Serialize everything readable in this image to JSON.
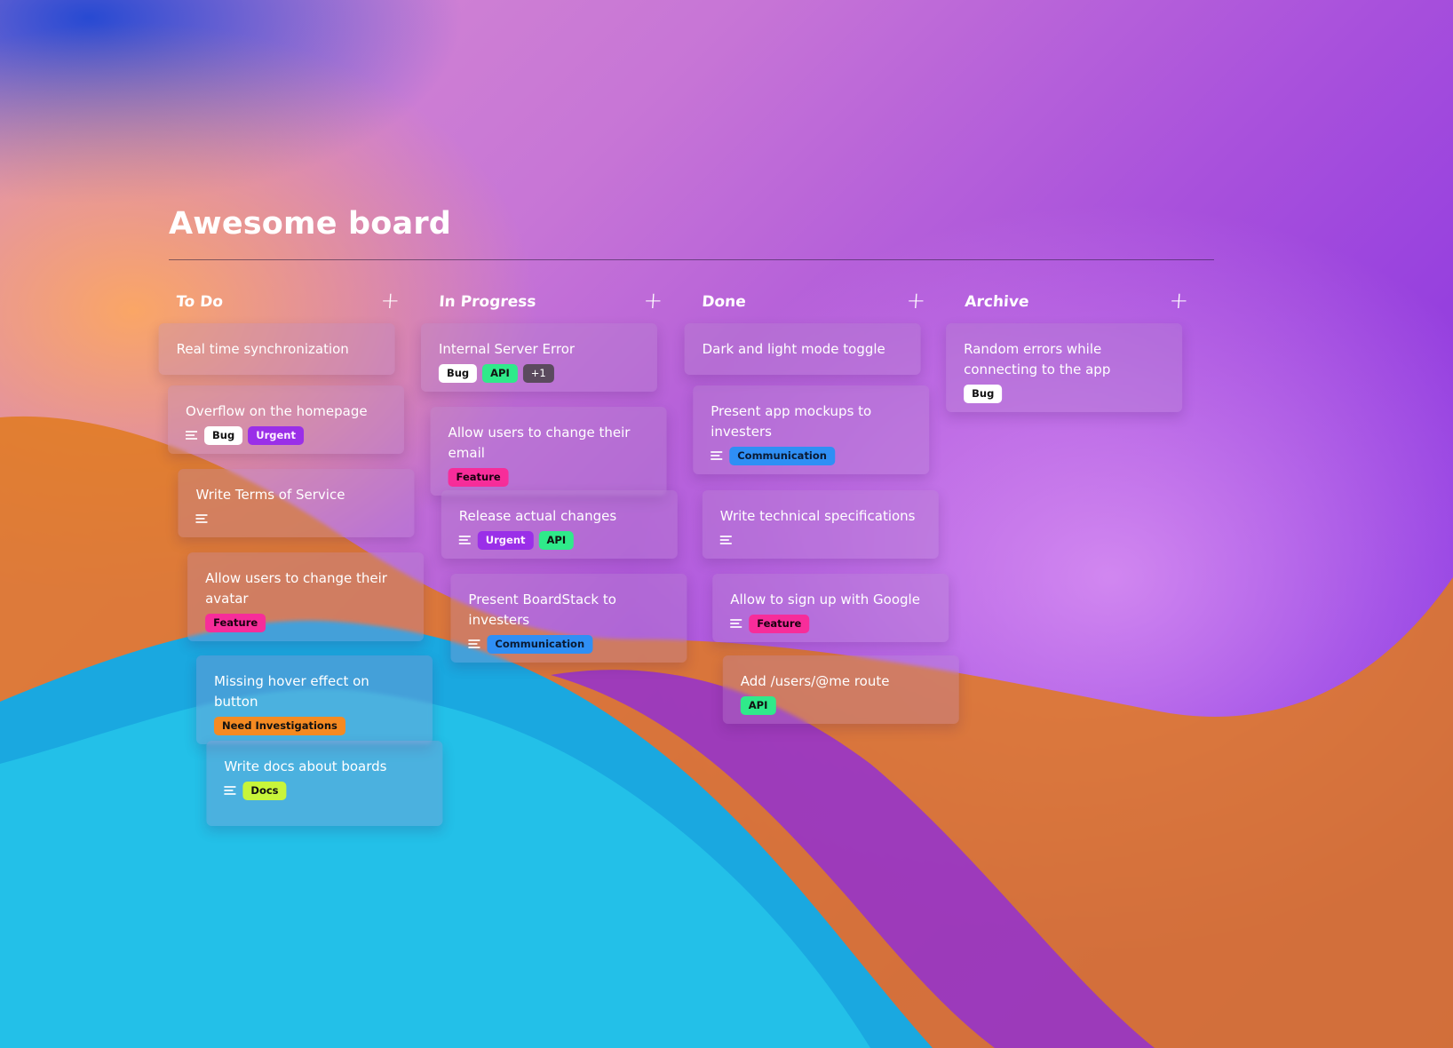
{
  "board": {
    "title": "Awesome board"
  },
  "columns": [
    {
      "title": "To Do",
      "add_label": "+",
      "cards": [
        {
          "title": "Real time synchronization",
          "has_description": false,
          "tags": []
        },
        {
          "title": "Overflow on the homepage",
          "has_description": true,
          "tags": [
            "Bug",
            "Urgent"
          ]
        },
        {
          "title": "Write Terms of Service",
          "has_description": true,
          "tags": []
        },
        {
          "title": "Allow users to change their avatar",
          "has_description": false,
          "tags": [
            "Feature"
          ]
        },
        {
          "title": "Missing hover effect on button",
          "has_description": false,
          "tags": [
            "Need Investigations"
          ]
        },
        {
          "title": "Write docs about boards",
          "has_description": true,
          "tags": [
            "Docs"
          ]
        }
      ]
    },
    {
      "title": "In Progress",
      "add_label": "+",
      "cards": [
        {
          "title": "Internal Server Error",
          "has_description": false,
          "tags": [
            "Bug",
            "API"
          ],
          "more": "+1"
        },
        {
          "title": "Allow users to change their email",
          "has_description": false,
          "tags": [
            "Feature"
          ]
        },
        {
          "title": "Release actual changes",
          "has_description": true,
          "tags": [
            "Urgent",
            "API"
          ]
        },
        {
          "title": "Present BoardStack to investers",
          "has_description": true,
          "tags": [
            "Communication"
          ]
        }
      ]
    },
    {
      "title": "Done",
      "add_label": "+",
      "cards": [
        {
          "title": "Dark and light mode toggle",
          "has_description": false,
          "tags": []
        },
        {
          "title": "Present app mockups to investers",
          "has_description": true,
          "tags": [
            "Communication"
          ]
        },
        {
          "title": "Write technical specifications",
          "has_description": true,
          "tags": []
        },
        {
          "title": "Allow to sign up with Google",
          "has_description": true,
          "tags": [
            "Feature"
          ]
        },
        {
          "title": "Add /users/@me route",
          "has_description": false,
          "tags": [
            "API"
          ]
        }
      ]
    },
    {
      "title": "Archive",
      "add_label": "+",
      "cards": [
        {
          "title": "Random errors while connecting to the app",
          "has_description": false,
          "tags": [
            "Bug"
          ]
        }
      ]
    }
  ]
}
